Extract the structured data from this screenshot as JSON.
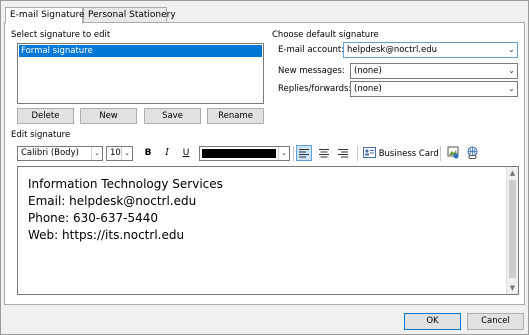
{
  "tabs": [
    {
      "label": "E-mail Signature"
    },
    {
      "label": "Personal Stationery"
    }
  ],
  "left": {
    "select_label": "Select signature to edit",
    "signatures": [
      "Formal signature"
    ],
    "buttons": {
      "delete": "Delete",
      "new": "New",
      "save": "Save",
      "rename": "Rename"
    }
  },
  "right": {
    "title": "Choose default signature",
    "email_account_label": "E-mail account:",
    "email_account_value": "helpdesk@noctrl.edu",
    "new_messages_label": "New messages:",
    "new_messages_value": "(none)",
    "replies_label": "Replies/forwards:",
    "replies_value": "(none)"
  },
  "edit": {
    "label": "Edit signature",
    "font_name": "Calibri (Body)",
    "font_size": "10",
    "bold": "B",
    "italic": "I",
    "underline": "U",
    "font_color": "#000000",
    "business_card": "Business Card",
    "lines": [
      "Information Technology Services",
      "Email: helpdesk@noctrl.edu",
      "Phone: 630-637-5440",
      "Web: https://its.noctrl.edu"
    ]
  },
  "footer": {
    "ok": "OK",
    "cancel": "Cancel"
  },
  "colors": {
    "selection": "#0078d7",
    "accent_pressed": "#cce4f7"
  },
  "icons": [
    "dropdown-arrow-icon",
    "align-left-icon",
    "align-center-icon",
    "align-right-icon",
    "business-card-icon",
    "insert-picture-icon",
    "insert-hyperlink-icon"
  ]
}
